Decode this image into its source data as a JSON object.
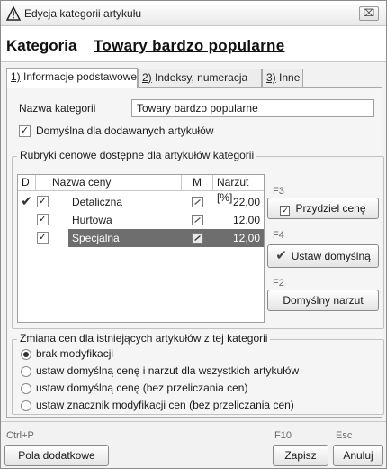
{
  "window": {
    "title": "Edycja kategorii artykułu",
    "close_label": "⌧"
  },
  "header": {
    "prefix": "Kategoria",
    "name": "Towary bardzo popularne"
  },
  "tabs": [
    {
      "key": "1)",
      "label": " Informacje podstawowe",
      "active": true
    },
    {
      "key": "2)",
      "label": " Indeksy, numeracja",
      "active": false
    },
    {
      "key": "3)",
      "label": " Inne",
      "active": false
    }
  ],
  "basic": {
    "name_label": "Nazwa kategorii",
    "name_value": "Towary bardzo popularne",
    "default_checkbox_label": "Domyślna dla dodawanych artykułów",
    "default_checked": true
  },
  "price_group": {
    "title": "Rubryki cenowe dostępne dla artykułów kategorii",
    "columns": [
      "D",
      "Nazwa ceny",
      "M",
      "Narzut [%]"
    ],
    "rows": [
      {
        "default_mark": "✔",
        "checked": true,
        "name": "Detaliczna",
        "markup": "22,00",
        "selected": false
      },
      {
        "default_mark": "",
        "checked": true,
        "name": "Hurtowa",
        "markup": "12,00",
        "selected": false
      },
      {
        "default_mark": "",
        "checked": true,
        "name": "Specjalna",
        "markup": "12,00",
        "selected": true
      }
    ],
    "buttons": [
      {
        "fkey": "F3",
        "label": "Przydziel cenę",
        "icon": "checkbox-icon"
      },
      {
        "fkey": "F4",
        "label": "Ustaw domyślną",
        "icon": "checkmark-icon"
      },
      {
        "fkey": "F2",
        "label": "Domyślny narzut",
        "icon": ""
      }
    ]
  },
  "price_change": {
    "title": "Zmiana cen dla istniejących artykułów z tej kategorii",
    "options": [
      {
        "label": "brak modyfikacji",
        "selected": true
      },
      {
        "label": "ustaw domyślną cenę i narzut dla wszystkich artykułów",
        "selected": false
      },
      {
        "label": "ustaw domyślną cenę (bez przeliczania cen)",
        "selected": false
      },
      {
        "label": "ustaw znacznik modyfikacji cen (bez przeliczania cen)",
        "selected": false
      }
    ]
  },
  "footer": {
    "extra_fkey": "Ctrl+P",
    "extra_label": "Pola dodatkowe",
    "save_fkey": "F10",
    "save_label": "Zapisz",
    "cancel_fkey": "Esc",
    "cancel_label": "Anuluj"
  },
  "colors": {
    "selected_row": "#6e6e6e",
    "window_bg": "#f2f2f2"
  }
}
